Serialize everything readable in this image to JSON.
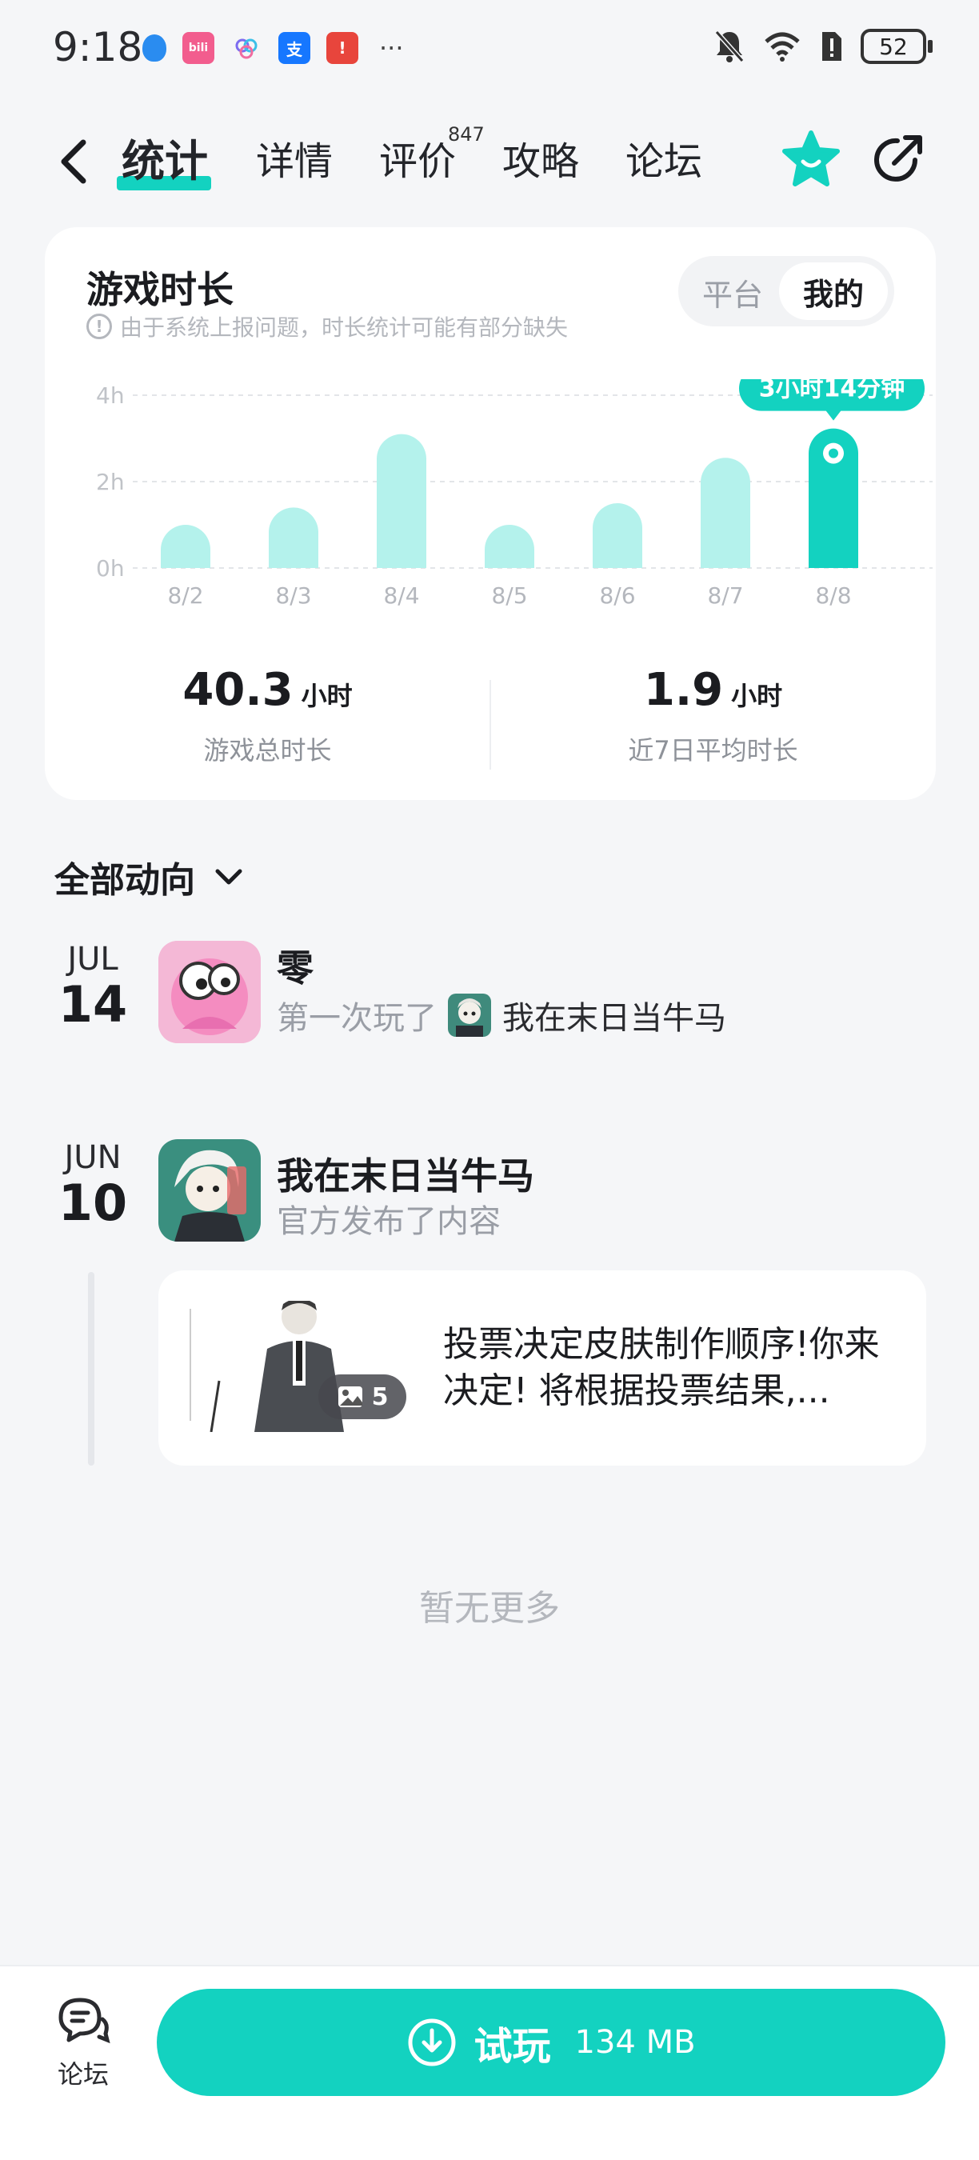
{
  "status_bar": {
    "time": "9:18",
    "battery": "52",
    "app_icons": [
      "shield-app",
      "bilibili-app",
      "cloud-app",
      "alipay-app",
      "alert-app"
    ],
    "more": "···"
  },
  "nav": {
    "tabs": [
      {
        "label": "统计",
        "active": true
      },
      {
        "label": "详情"
      },
      {
        "label": "评价",
        "badge": "847"
      },
      {
        "label": "攻略"
      },
      {
        "label": "论坛"
      }
    ],
    "accent_color": "#13d2c0"
  },
  "stats_card": {
    "title": "游戏时长",
    "note": "由于系统上报问题，时长统计可能有部分缺失",
    "toggle": {
      "left": "平台",
      "right": "我的"
    },
    "total": {
      "value": "40.3",
      "unit": "小时",
      "label": "游戏总时长"
    },
    "average": {
      "value": "1.9",
      "unit": "小时",
      "label": "近7日平均时长"
    }
  },
  "chart_data": {
    "type": "bar",
    "categories": [
      "8/2",
      "8/3",
      "8/4",
      "8/5",
      "8/6",
      "8/7",
      "8/8"
    ],
    "values": [
      1.0,
      1.4,
      3.1,
      1.0,
      1.5,
      2.55,
      3.23
    ],
    "y_ticks": [
      "0h",
      "2h",
      "4h"
    ],
    "ylim": [
      0,
      4
    ],
    "highlight_index": 6,
    "highlight_label": "3小时14分钟",
    "colors": {
      "bar": "#b4f2ec",
      "highlight": "#13d2c0"
    },
    "grid": true
  },
  "feed": {
    "heading": "全部动向",
    "items": [
      {
        "month": "JUL",
        "day": "14",
        "name": "零",
        "action": "第一次玩了",
        "game": "我在末日当牛马"
      },
      {
        "month": "JUN",
        "day": "10",
        "name": "我在末日当牛马",
        "action": "官方发布了内容",
        "post": {
          "text": "投票决定皮肤制作顺序!你来决定! 将根据投票结果,...",
          "image_count": "5"
        }
      }
    ],
    "end_text": "暂无更多"
  },
  "bottom_bar": {
    "forum_label": "论坛",
    "play_label": "试玩",
    "size": "134 MB"
  }
}
